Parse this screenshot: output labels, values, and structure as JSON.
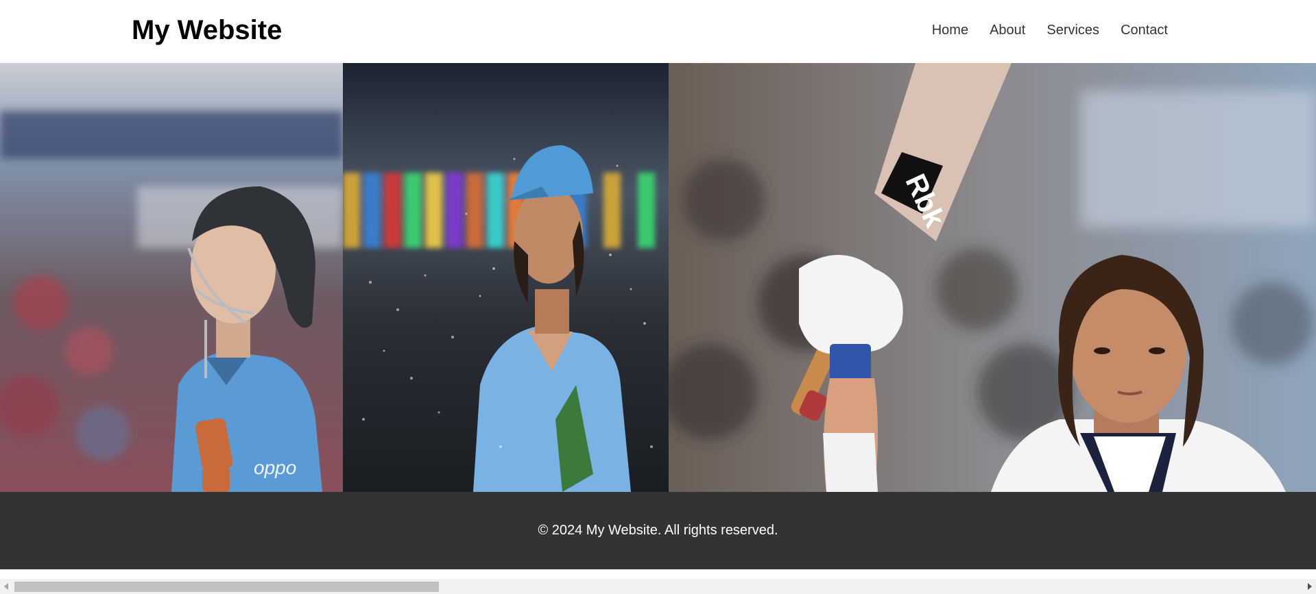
{
  "header": {
    "title": "My Website",
    "nav": [
      "Home",
      "About",
      "Services",
      "Contact"
    ]
  },
  "footer": {
    "text": "© 2024 My Website. All rights reserved."
  },
  "scrollbar": {
    "position_fraction": 0.0,
    "visible_fraction": 0.33
  },
  "colors": {
    "footer_bg": "#333333",
    "jersey_blue": "#5b9bd5",
    "nav_text": "#333333"
  },
  "gallery": {
    "photos": [
      {
        "name": "cricketer-helmet-photo"
      },
      {
        "name": "cricketer-rain-photo"
      },
      {
        "name": "cricketer-raised-bat-photo"
      }
    ]
  }
}
